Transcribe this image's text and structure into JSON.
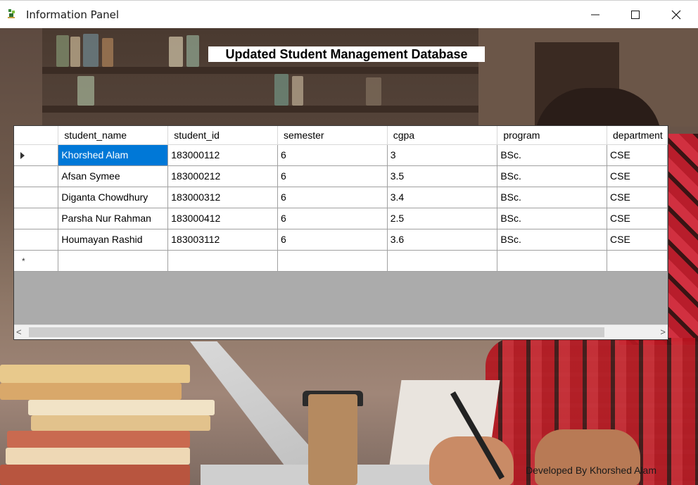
{
  "window": {
    "title": "Information Panel",
    "controls": {
      "minimize": "minimize-icon",
      "maximize": "maximize-icon",
      "close": "close-icon"
    }
  },
  "heading": "Updated Student Management Database",
  "grid": {
    "columns": [
      "student_name",
      "student_id",
      "semester",
      "cgpa",
      "program",
      "department"
    ],
    "rows": [
      [
        "Khorshed Alam",
        "183000112",
        "6",
        "3",
        "BSc.",
        "CSE"
      ],
      [
        "Afsan Symee",
        "183000212",
        "6",
        "3.5",
        "BSc.",
        "CSE"
      ],
      [
        "Diganta Chowdhury",
        "183000312",
        "6",
        "3.4",
        "BSc.",
        "CSE"
      ],
      [
        "Parsha Nur Rahman",
        "183000412",
        "6",
        "2.5",
        "BSc.",
        "CSE"
      ],
      [
        "Houmayan Rashid",
        "183003112",
        "6",
        "3.6",
        "BSc.",
        "CSE"
      ]
    ],
    "current_row_marker": "▶",
    "new_row_marker": "*",
    "scroll_left": "<",
    "scroll_right": ">"
  },
  "footer": {
    "credit": "Developed By Khorshed Alam"
  },
  "colors": {
    "selection": "#0078d7",
    "grid_background": "#ababab"
  }
}
